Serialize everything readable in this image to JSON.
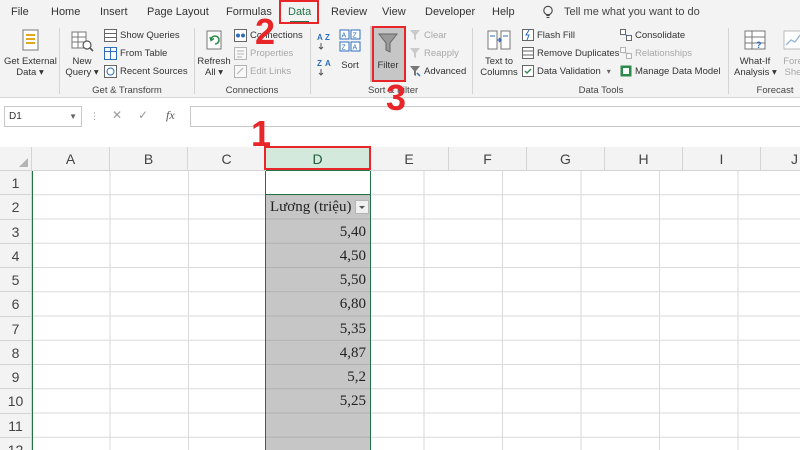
{
  "tabs": [
    {
      "label": "File",
      "active": false
    },
    {
      "label": "Home",
      "active": false
    },
    {
      "label": "Insert",
      "active": false
    },
    {
      "label": "Page Layout",
      "active": false
    },
    {
      "label": "Formulas",
      "active": false
    },
    {
      "label": "Data",
      "active": true
    },
    {
      "label": "Review",
      "active": false
    },
    {
      "label": "View",
      "active": false
    },
    {
      "label": "Developer",
      "active": false
    },
    {
      "label": "Help",
      "active": false
    }
  ],
  "tell_me": "Tell me what you want to do",
  "ribbon": {
    "get_external": {
      "line1": "Get External",
      "line2": "Data ▾"
    },
    "new_query": {
      "line1": "New",
      "line2": "Query ▾"
    },
    "show_queries": "Show Queries",
    "from_table": "From Table",
    "recent_sources": "Recent Sources",
    "group_get_transform": "Get & Transform",
    "refresh": {
      "line1": "Refresh",
      "line2": "All ▾"
    },
    "connections": "Connections",
    "properties": "Properties",
    "edit_links": "Edit Links",
    "group_connections": "Connections",
    "sort": "Sort",
    "filter": "Filter",
    "clear": "Clear",
    "reapply": "Reapply",
    "advanced": "Advanced",
    "group_sort_filter": "Sort & Filter",
    "text_to_columns": {
      "line1": "Text to",
      "line2": "Columns"
    },
    "flash_fill": "Flash Fill",
    "remove_duplicates": "Remove Duplicates",
    "data_validation": "Data Validation",
    "consolidate": "Consolidate",
    "relationships": "Relationships",
    "manage_data_model": "Manage Data Model",
    "group_data_tools": "Data Tools",
    "what_if": {
      "line1": "What-If",
      "line2": "Analysis ▾"
    },
    "forecast_sheet": {
      "line1": "Fore",
      "line2": "She"
    },
    "group_forecast": "Forecast"
  },
  "formula_bar": {
    "name_box": "D1",
    "cancel_glyph": "✕",
    "enter_glyph": "✓",
    "fx_glyph": "fx",
    "value": ""
  },
  "sheet": {
    "columns": [
      "A",
      "B",
      "C",
      "D",
      "E",
      "F",
      "G",
      "H",
      "I",
      "J"
    ],
    "rows": [
      "1",
      "2",
      "3",
      "4",
      "5",
      "6",
      "7",
      "8",
      "9",
      "10",
      "11",
      "12"
    ],
    "selected_column": "D",
    "column_d_cells": [
      {
        "row": "2",
        "value": "Lương (triệu)",
        "kind": "header"
      },
      {
        "row": "3",
        "value": "5,40"
      },
      {
        "row": "4",
        "value": "4,50"
      },
      {
        "row": "5",
        "value": "5,50"
      },
      {
        "row": "6",
        "value": "6,80"
      },
      {
        "row": "7",
        "value": "5,35"
      },
      {
        "row": "8",
        "value": "4,87"
      },
      {
        "row": "9",
        "value": "5,2"
      },
      {
        "row": "10",
        "value": "5,25"
      }
    ]
  },
  "annotations": {
    "step1": "1",
    "step2": "2",
    "step3": "3",
    "color": "#e8262a"
  },
  "colors": {
    "accent": "#217346",
    "selection_fill": "#c6c6c6",
    "header_selected": "#d3e9dc"
  }
}
